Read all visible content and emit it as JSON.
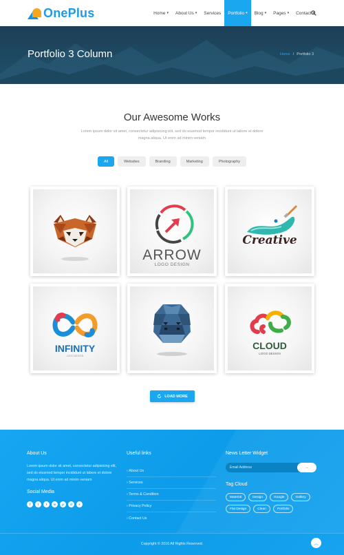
{
  "brand": {
    "name": "OnePlus"
  },
  "nav": {
    "items": [
      {
        "label": "Home",
        "caret": true
      },
      {
        "label": "About Us",
        "caret": true
      },
      {
        "label": "Services",
        "caret": false
      },
      {
        "label": "Portfolio",
        "caret": true,
        "active": true
      },
      {
        "label": "Blog",
        "caret": true
      },
      {
        "label": "Pages",
        "caret": true
      },
      {
        "label": "Contact",
        "caret": true
      }
    ],
    "caret_glyph": "▾"
  },
  "banner": {
    "title": "Portfolio 3 Column",
    "breadcrumb": {
      "home": "Home",
      "separator": "/",
      "current": "Portfolio 3"
    }
  },
  "section": {
    "title": "Our Awesome Works",
    "description": "Lorem ipsum dolor sit amet, consectetur adipisicing elit, sed do eiusmod tempor incididunt ut labore et dolore magna aliqua. Ut enim ad minim veniam"
  },
  "filters": [
    {
      "label": "All",
      "active": true
    },
    {
      "label": "Websites"
    },
    {
      "label": "Branding"
    },
    {
      "label": "Marketing"
    },
    {
      "label": "Photography"
    }
  ],
  "portfolio": {
    "arrow": {
      "word": "ARROW",
      "sub": "LOGO DESIGN"
    },
    "creative": {
      "word": "Creative"
    },
    "infinity": {
      "word": "INFINITY",
      "sub": "LOGO DESIGN"
    },
    "cloud": {
      "word": "CLOUD",
      "sub": "LOGO DESIGN"
    }
  },
  "load_more": {
    "label": "LOAD MORE"
  },
  "footer": {
    "about": {
      "title": "About Us",
      "text": "Lorem ipsum dolor sit amet, consectetur adipisicing elit, sed do eiusmod tempor incididunt ut labore et dolore magna aliqua. Ut enim ad minim veniam"
    },
    "social": {
      "title": "Social Media",
      "icons": [
        "f",
        "t",
        "t",
        "in",
        "p",
        "d",
        "s"
      ]
    },
    "links": {
      "title": "Useful links",
      "items": [
        "About Us",
        "Services",
        "Terms & Condition",
        "Privacy Policy",
        "Contact Us"
      ]
    },
    "newsletter": {
      "title": "News Letter Widget",
      "placeholder": "Email Address",
      "button": "→"
    },
    "tags": {
      "title": "Tag Cloud",
      "items": [
        "Material",
        "Design",
        "Google",
        "Gallery",
        "Flat Design",
        "Clean",
        "Portfolio"
      ]
    },
    "copyright": "Copyright © 2016 All Rights Reserved.",
    "to_top": "︿"
  },
  "colors": {
    "accent": "#1ba6f0",
    "banner": "#1e4a63",
    "footer": "#0c9ce9"
  }
}
